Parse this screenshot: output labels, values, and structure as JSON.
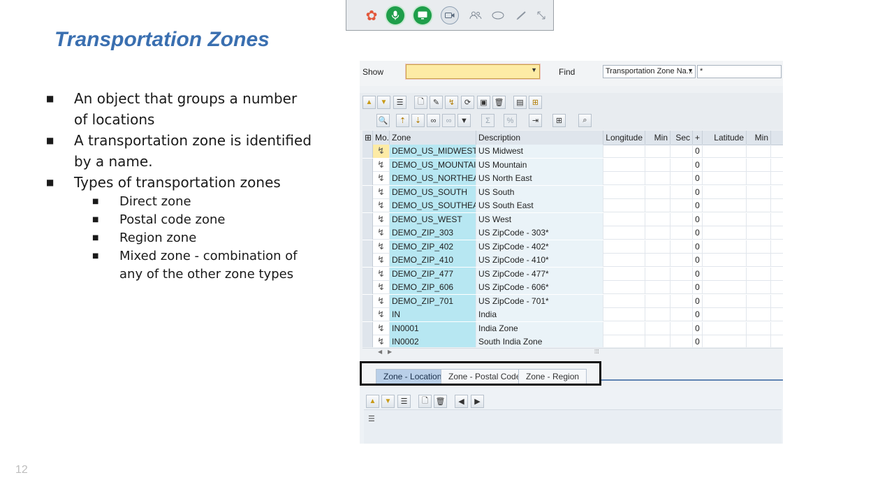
{
  "slide": {
    "title": "Transportation Zones",
    "page_number": "12",
    "bullets": [
      {
        "level": 1,
        "text": "An object that groups a number of locations"
      },
      {
        "level": 1,
        "text": "A transportation zone is identified by a name."
      },
      {
        "level": 1,
        "text": "Types of transportation zones"
      },
      {
        "level": 2,
        "text": "Direct zone"
      },
      {
        "level": 2,
        "text": "Postal code zone"
      },
      {
        "level": 2,
        "text": "Region zone"
      },
      {
        "level": 2,
        "text": "Mixed zone -  combination of any of the other zone types"
      }
    ]
  },
  "meeting_toolbar": {
    "buttons": [
      "app-logo-icon",
      "microphone-icon",
      "screen-share-icon",
      "camera-icon",
      "participants-icon",
      "chat-icon",
      "annotate-pen-icon",
      "expand-icon"
    ]
  },
  "sap": {
    "show_label": "Show",
    "show_value": "",
    "find_label": "Find",
    "find_select_value": "Transportation Zone Na...",
    "find_input_value": "*",
    "columns": {
      "mo": "Mo..",
      "zone": "Zone",
      "description": "Description",
      "longitude": "Longitude",
      "min": "Min",
      "sec": "Sec",
      "plus": "+",
      "latitude": "Latitude",
      "min2": "Min"
    },
    "rows": [
      {
        "zone": "DEMO_US_MIDWEST",
        "description": "US Midwest",
        "plus": "0"
      },
      {
        "zone": "DEMO_US_MOUNTAIN",
        "description": "US Mountain",
        "plus": "0"
      },
      {
        "zone": "DEMO_US_NORTHEAST",
        "description": "US North East",
        "plus": "0"
      },
      {
        "zone": "DEMO_US_SOUTH",
        "description": "US South",
        "plus": "0"
      },
      {
        "zone": "DEMO_US_SOUTHEAST",
        "description": "US South East",
        "plus": "0"
      },
      {
        "zone": "DEMO_US_WEST",
        "description": "US West",
        "plus": "0"
      },
      {
        "zone": "DEMO_ZIP_303",
        "description": "US ZipCode - 303*",
        "plus": "0"
      },
      {
        "zone": "DEMO_ZIP_402",
        "description": "US ZipCode - 402*",
        "plus": "0"
      },
      {
        "zone": "DEMO_ZIP_410",
        "description": "US ZipCode - 410*",
        "plus": "0"
      },
      {
        "zone": "DEMO_ZIP_477",
        "description": "US ZipCode - 477*",
        "plus": "0"
      },
      {
        "zone": "DEMO_ZIP_606",
        "description": "US ZipCode - 606*",
        "plus": "0"
      },
      {
        "zone": "DEMO_ZIP_701",
        "description": "US ZipCode - 701*",
        "plus": "0"
      },
      {
        "zone": "IN",
        "description": "India",
        "plus": "0"
      },
      {
        "zone": "IN0001",
        "description": "India Zone",
        "plus": "0"
      },
      {
        "zone": "IN0002",
        "description": "South India Zone",
        "plus": "0"
      }
    ],
    "tabs": [
      {
        "label": "Zone - Location",
        "active": true
      },
      {
        "label": "Zone - Postal Code",
        "active": false
      },
      {
        "label": "Zone - Region",
        "active": false
      }
    ]
  },
  "colors": {
    "title": "#3a6fb0",
    "zone_column": "#b7e7f2",
    "active_tab": "#b9cfe8",
    "show_field": "#fdeba5",
    "tab_highlight_box": "#111111"
  }
}
